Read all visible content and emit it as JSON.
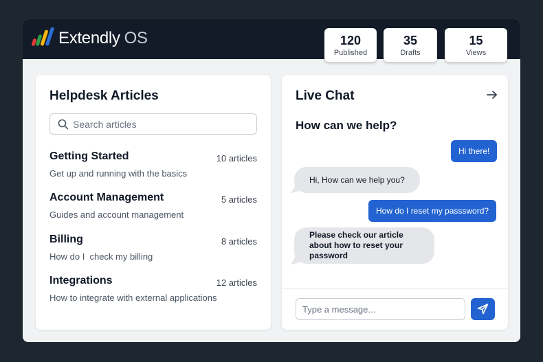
{
  "app": {
    "brand_name": "Extendly",
    "brand_suffix": "OS"
  },
  "stats": [
    {
      "value": "120",
      "label": "Published"
    },
    {
      "value": "35",
      "label": "Drafts"
    },
    {
      "value": "15",
      "label": "Views"
    }
  ],
  "helpdesk": {
    "title": "Helpdesk Articles",
    "search_placeholder": "Search articles",
    "articles": [
      {
        "title": "Getting Started",
        "count": "10 articles",
        "description": "Get up and running with the basics"
      },
      {
        "title": "Account Management",
        "count": "5 articles",
        "description": "Guides and account management"
      },
      {
        "title": "Billing",
        "count": "8 articles",
        "description": "How do I  check my billing"
      },
      {
        "title": "Integrations",
        "count": "12 articles",
        "description": "How to integrate with external applications"
      }
    ]
  },
  "chat": {
    "title": "Live Chat",
    "subtitle": "How can we help?",
    "messages": [
      {
        "from": "user",
        "text": "Hi there!"
      },
      {
        "from": "agent",
        "text": "Hi, How can we help you?"
      },
      {
        "from": "user",
        "text": "How do I reset my passsword?"
      },
      {
        "from": "agent",
        "text": "Please check our article about how to reset your password"
      }
    ],
    "input_placeholder": "Type a message..."
  },
  "icons": {
    "logo": "logo-bars-icon",
    "search": "search-icon",
    "expand": "arrow-right-icon",
    "send": "send-icon"
  },
  "colors": {
    "topbar": "#131b28",
    "accent": "#2363d1",
    "logo_colors": [
      "#e53935",
      "#2e9e47",
      "#f5b614",
      "#2b6fd6"
    ]
  }
}
